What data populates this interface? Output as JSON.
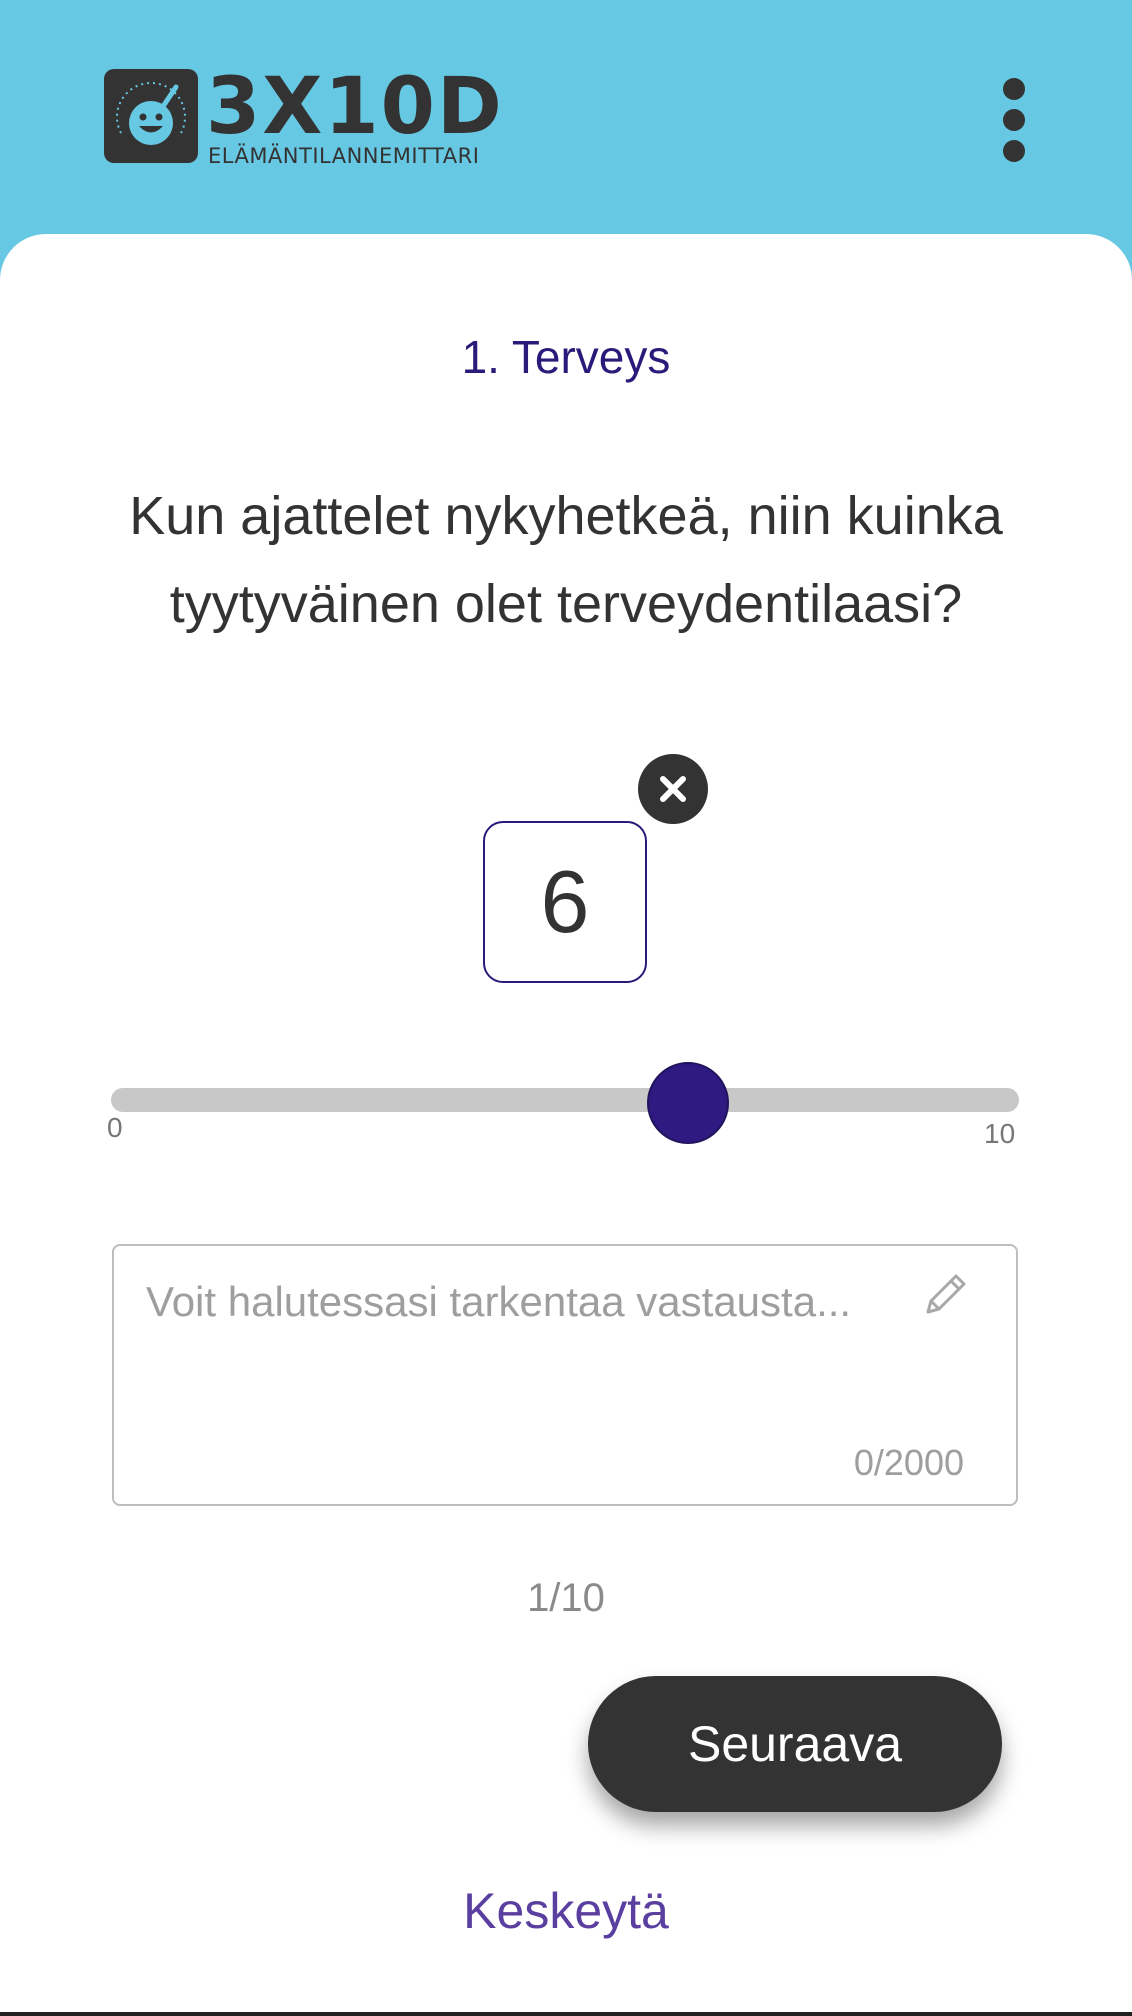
{
  "header": {
    "logo_title": "3X10D",
    "logo_subtitle": "ELÄMÄNTILANNEMITTARI",
    "menu_icon": "more-vertical-icon",
    "background_color": "#66c8e2"
  },
  "question": {
    "section_title": "1. Terveys",
    "text": "Kun ajattelet nykyhetkeä, niin kuinka tyytyväinen olet terveydentilaasi?"
  },
  "answer": {
    "value": "6",
    "clear_icon": "close-icon"
  },
  "slider": {
    "min_label": "0",
    "max_label": "10",
    "value": 6,
    "accent_color": "#2e1a80"
  },
  "comment": {
    "placeholder": "Voit halutessasi tarkentaa vastausta...",
    "value": "",
    "counter": "0/2000",
    "icon": "pencil-icon"
  },
  "progress": {
    "text": "1/10"
  },
  "actions": {
    "next_label": "Seuraava",
    "cancel_label": "Keskeytä"
  }
}
